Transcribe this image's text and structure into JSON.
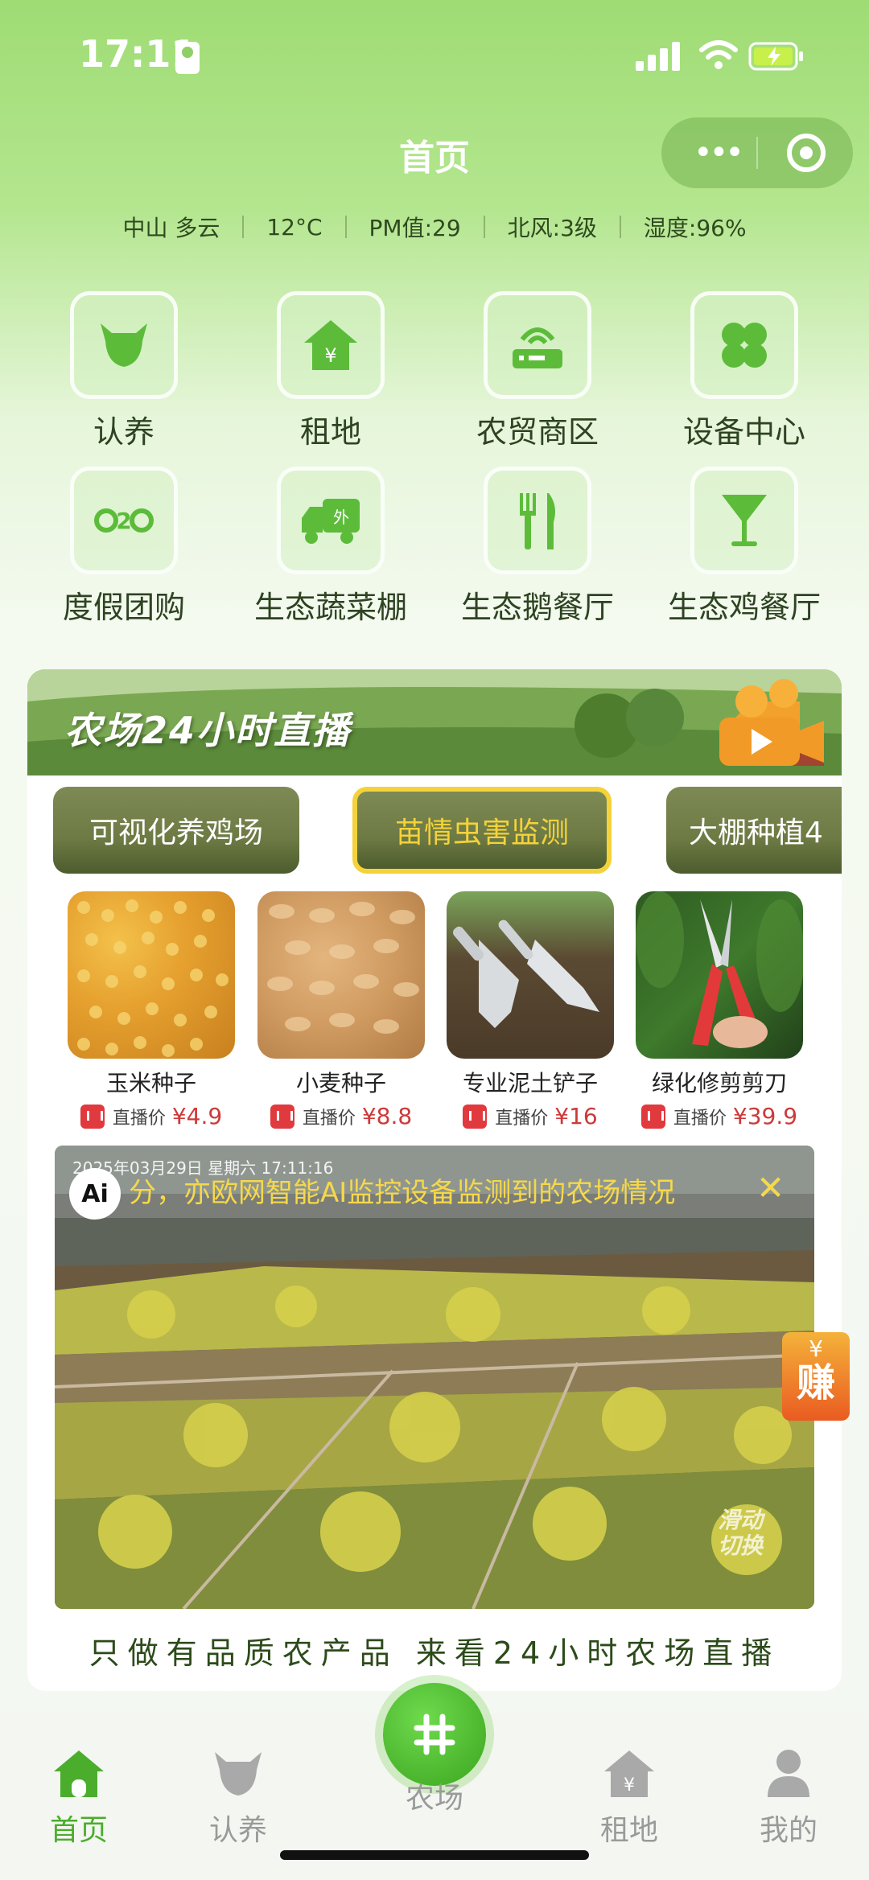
{
  "status_bar": {
    "time": "17:11"
  },
  "nav": {
    "title": "首页"
  },
  "weather": {
    "city": "中山 多云",
    "temp": "12°C",
    "pm": "PM值:29",
    "wind": "北风:3级",
    "humidity": "湿度:96%"
  },
  "menu": {
    "items": [
      {
        "label": "认养",
        "icon": "cow-icon"
      },
      {
        "label": "租地",
        "icon": "house-yen-icon"
      },
      {
        "label": "农贸商区",
        "icon": "router-icon"
      },
      {
        "label": "设备中心",
        "icon": "clover-icon"
      },
      {
        "label": "度假团购",
        "icon": "o2o-icon"
      },
      {
        "label": "生态蔬菜棚",
        "icon": "delivery-truck-icon"
      },
      {
        "label": "生态鹅餐厅",
        "icon": "fork-knife-icon"
      },
      {
        "label": "生态鸡餐厅",
        "icon": "cocktail-icon"
      }
    ]
  },
  "live": {
    "banner_title": "农场24小时直播",
    "tabs": [
      "可视化养鸡场",
      "苗情虫害监测",
      "大棚种植4"
    ],
    "active_tab_index": 1
  },
  "products": [
    {
      "name": "玉米种子",
      "price_label": "直播价",
      "price": "¥4.9"
    },
    {
      "name": "小麦种子",
      "price_label": "直播价",
      "price": "¥8.8"
    },
    {
      "name": "专业泥土铲子",
      "price_label": "直播价",
      "price": "¥16"
    },
    {
      "name": "绿化修剪剪刀",
      "price_label": "直播价",
      "price": "¥39.9"
    }
  ],
  "video": {
    "timestamp": "2025年03月29日 星期六 17:11:16",
    "ai_badge": "Ai",
    "ai_text": "分，亦欧网智能AI监控设备监测到的农场情况",
    "close": "✕",
    "swipe_hint_1": "滑动",
    "swipe_hint_2": "切换"
  },
  "earn": {
    "yen": "¥",
    "label": "赚"
  },
  "slogan": "只做有品质农产品 来看24小时农场直播",
  "tabbar": {
    "items": [
      {
        "label": "首页",
        "icon": "home-icon"
      },
      {
        "label": "认养",
        "icon": "cow-icon"
      },
      {
        "label": "农场",
        "icon": "farm-grid-icon"
      },
      {
        "label": "租地",
        "icon": "house-yen-icon"
      },
      {
        "label": "我的",
        "icon": "person-icon"
      }
    ],
    "active_index": 0
  },
  "colors": {
    "accent": "#4aad2c",
    "header_green": "#9fdc74",
    "tab_active_border": "#f4d23a",
    "price_red": "#cc3a3a"
  }
}
